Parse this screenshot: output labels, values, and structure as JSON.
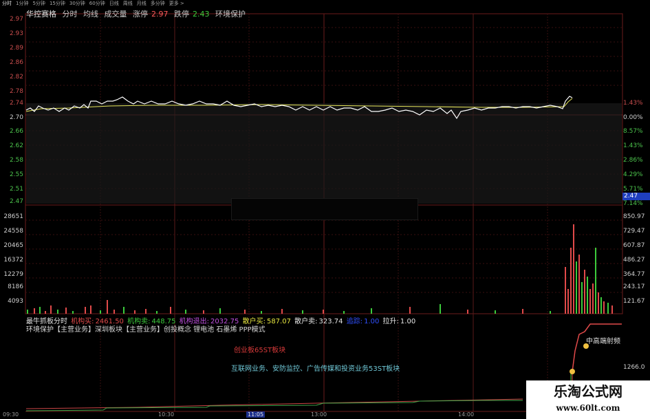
{
  "tabs": [
    "分时",
    "1分钟",
    "5分钟",
    "15分钟",
    "30分钟",
    "60分钟",
    "日线",
    "周线",
    "月线",
    "多分钟",
    "更多 >"
  ],
  "header": {
    "stock_name": "华控赛格",
    "items": [
      "分时",
      "均线",
      "成交量"
    ],
    "limit_up_label": "涨停",
    "limit_up_value": "2.97",
    "limit_down_label": "跌停",
    "limit_down_value": "2.43",
    "sector": "环境保护"
  },
  "price_axis_left": [
    "2.97",
    "2.93",
    "2.89",
    "2.86",
    "2.82",
    "2.78",
    "2.74",
    "2.70",
    "2.66",
    "2.62",
    "2.58",
    "2.55",
    "2.51",
    "2.47"
  ],
  "pct_axis_right": [
    "1.43%",
    "0.00%",
    "1.43%",
    "2.86%",
    "4.29%",
    "5.71%",
    "7.14%",
    "8.57%"
  ],
  "volume_axis_left": [
    "28651",
    "24558",
    "20465",
    "16372",
    "12279",
    "8186",
    "4093"
  ],
  "volume_axis_right": [
    "850.97",
    "729.47",
    "607.87",
    "486.27",
    "364.77",
    "243.17",
    "121.67"
  ],
  "price_tag": "2.47",
  "indicator": {
    "name": "最牛抓板分时",
    "items": [
      {
        "label": "机构买:",
        "value": "2461.50",
        "color": "#e24a4a"
      },
      {
        "label": "机构卖:",
        "value": "448.75",
        "color": "#3ccc3c"
      },
      {
        "label": "机构退出:",
        "value": "2032.75",
        "color": "#c050e0"
      },
      {
        "label": "散户买:",
        "value": "587.07",
        "color": "#e6e640"
      },
      {
        "label": "散户卖:",
        "value": "323.74",
        "color": "#e6e6e6"
      },
      {
        "label": "追踪:",
        "value": "1.00",
        "color": "#3050ff"
      },
      {
        "label": "拉升:",
        "value": "1.00",
        "color": "#e6e6e6"
      }
    ],
    "concepts": "环境保护【主营业务】深圳板块【主营业务】创投概念 锂电池 石墨烯 PPP模式",
    "red_note": "创业板65ST板块",
    "cyan_note": "互联网业务、安防监控、广告传媒和投资业务53ST板块",
    "callout": "中高端射频",
    "right_value": "1266.0"
  },
  "time_labels": [
    "09:30",
    "10:30",
    "11:05",
    "13:00",
    "14:00"
  ],
  "watermark": {
    "line1": "乐淘公式网",
    "line2": "www.60lt.com"
  },
  "colors": {
    "up": "#ff5a5a",
    "down": "#3ccc3c",
    "grid": "#5a1a1a",
    "price_line": "#ffffff",
    "avg_line": "#e6e65a"
  }
}
